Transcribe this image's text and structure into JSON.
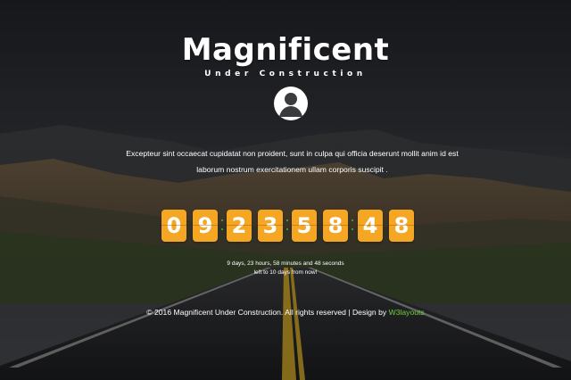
{
  "header": {
    "title": "Magnificent",
    "subtitle": "Under Construction"
  },
  "intro": {
    "line1": "Excepteur sint occaecat cupidatat non proident, sunt in culpa qui officia deserunt mollit anim id est",
    "line2": "laborum nostrum exercitationem ullam corporis suscipit ."
  },
  "countdown": {
    "digits": [
      "0",
      "9",
      "2",
      "3",
      "5",
      "8",
      "4",
      "8"
    ],
    "accent_color": "#f5a623",
    "separator_color": "#3dbb3d",
    "caption_line1": "9 days, 23 hours, 58 minutes and 48 seconds",
    "caption_line2": "left to 10 days from now!"
  },
  "footer": {
    "text": "© 2016 Magnificent Under Construction. All rights reserved | Design by ",
    "link_label": "W3layouts",
    "link_color": "#6fcf3a"
  },
  "icons": {
    "avatar": "user-avatar-icon"
  }
}
